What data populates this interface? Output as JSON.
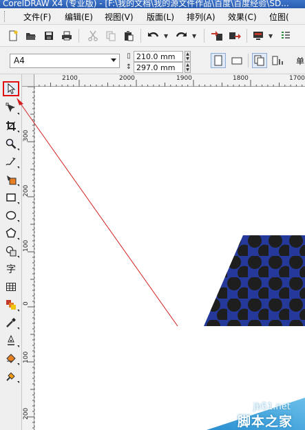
{
  "window": {
    "title": "CorelDRAW X4 (专业版) - [F:\\我的文档\\我的源文件作品\\百度\\百度经验\\SD..."
  },
  "menu": {
    "file": "文件(F)",
    "edit": "编辑(E)",
    "view": "视图(V)",
    "layout": "版面(L)",
    "arrange": "排列(A)",
    "effects": "效果(C)",
    "bitmaps": "位图("
  },
  "toolbar": {
    "icons": [
      "new-document-icon",
      "open-icon",
      "save-icon",
      "print-icon",
      "cut-icon",
      "copy-icon",
      "paste-icon",
      "undo-icon",
      "redo-icon",
      "import-icon",
      "export-icon",
      "application-launcher-icon",
      "welcome-screen-icon"
    ]
  },
  "property_bar": {
    "page_size": "A4",
    "width": "210.0 mm",
    "height": "297.0 mm",
    "trailing_label": "单"
  },
  "rulers": {
    "top_labels": [
      "2100",
      "2000",
      "1900",
      "1800",
      "1700"
    ],
    "left_labels": [
      "300",
      "200",
      "100",
      "0",
      "100",
      "200"
    ]
  },
  "toolbox": {
    "tools": [
      "pick-tool",
      "shape-tool",
      "crop-tool",
      "zoom-tool",
      "freehand-tool",
      "smart-fill-tool",
      "rectangle-tool",
      "ellipse-tool",
      "polygon-tool",
      "basic-shapes-tool",
      "text-tool",
      "table-tool",
      "blend-tool",
      "eyedropper-tool",
      "outline-tool",
      "fill-tool",
      "interactive-fill-tool"
    ],
    "text_tool_label": "字",
    "selected": "pick-tool"
  },
  "canvas": {
    "shape_fill": "#24399a",
    "dot_color": "#1e1e1e",
    "annotation_color": "#d42020"
  },
  "watermark": {
    "site": "jb51.net",
    "name": "脚本之家"
  }
}
